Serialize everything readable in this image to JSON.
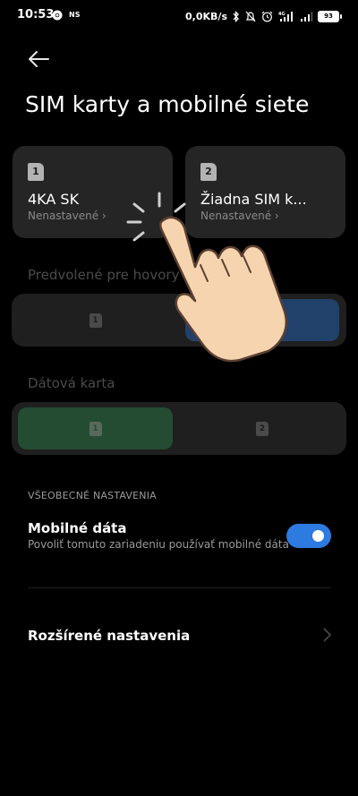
{
  "status_bar": {
    "time": "10:53",
    "ns_label": "NS",
    "net_speed": "0,0KB/s",
    "battery": "93"
  },
  "page": {
    "title": "SIM karty a mobilné siete"
  },
  "sim_cards": [
    {
      "slot": "1",
      "name": "4KA SK",
      "status": "Nenastavené ›"
    },
    {
      "slot": "2",
      "name": "Žiadna SIM k...",
      "status": "Nenastavené ›"
    }
  ],
  "calls": {
    "label": "Predvolené pre hovory",
    "options": [
      "1",
      "2"
    ],
    "selected": "2"
  },
  "data_card": {
    "label": "Dátová karta",
    "options": [
      "1",
      "2"
    ],
    "selected": "1"
  },
  "general": {
    "header": "VŠEOBECNÉ NASTAVENIA",
    "mobile_data_title": "Mobilné dáta",
    "mobile_data_sub": "Povoliť tomuto zariadeniu používať mobilné dáta",
    "mobile_data_enabled": true,
    "advanced_label": "Rozšírené nastavenia"
  },
  "colors": {
    "background": "#000000",
    "card": "#252525",
    "toggle_on": "#2d7ae0",
    "calls_selected": "#22416a",
    "data_selected": "#244c33"
  }
}
